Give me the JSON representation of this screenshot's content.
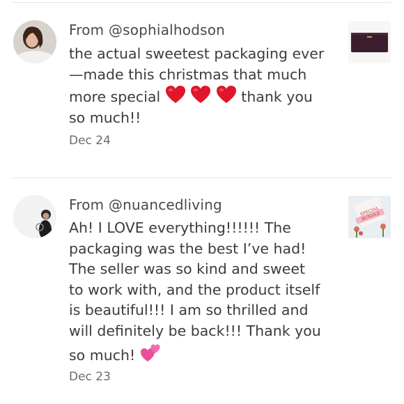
{
  "reviews": [
    {
      "author": "From @sophialhodson",
      "lines": [
        "the actual sweetest packaging ever",
        "—made this christmas that much",
        "more special",
        "thank you",
        "so much!!"
      ],
      "emoji": [
        "heart-emoji",
        "heart-emoji",
        "heart-emoji"
      ],
      "date": "Dec 24"
    },
    {
      "author": "From @nuancedliving",
      "lines": [
        "Ah! I LOVE everything!!!!!! The",
        "packaging was the best I’ve had!",
        "The seller was so kind and sweet",
        "to work with, and the product itself",
        "is beautiful!!! I am so thrilled and",
        "will definitely be back!!! Thank you",
        "so much!"
      ],
      "emoji": [
        "two-hearts-emoji"
      ],
      "date": "Dec 23",
      "thumb_text": [
        "SPECIAL",
        "BUNDLE"
      ]
    }
  ],
  "colors": {
    "text": "#3c3c3c",
    "date": "#6b6b6b",
    "divider": "#e6e6e6",
    "heart": "#e0162b",
    "pink": "#e8509b"
  }
}
